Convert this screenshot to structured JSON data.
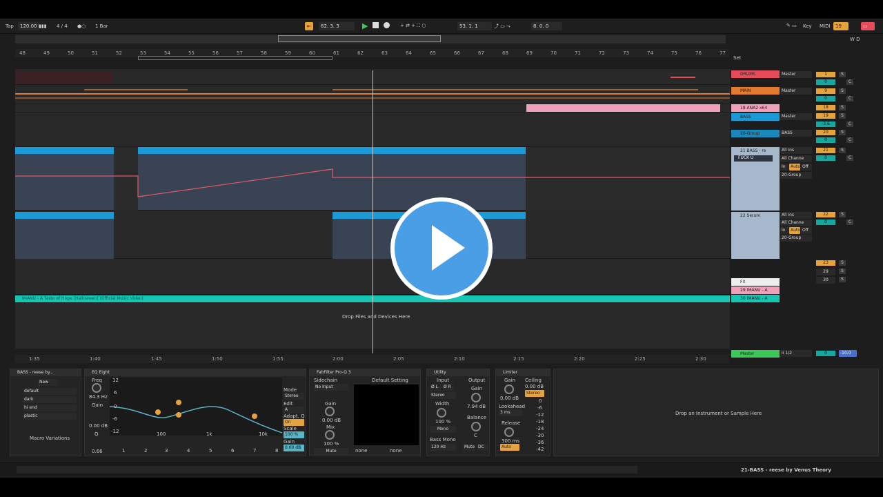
{
  "transport": {
    "tap": "Tap",
    "tempo": "120.00",
    "sig": "4 / 4",
    "quant": "1 Bar",
    "position": "62.   3.   3",
    "loop_end": "53.   1.   1",
    "loop_len": "8.   0.   0",
    "key": "Key",
    "midi": "MIDI",
    "cpu": "19 %",
    "d_label": "D",
    "w_label": "W"
  },
  "overview": {
    "ruler": [
      "48",
      "49",
      "50",
      "51",
      "52",
      "53",
      "54",
      "55",
      "56",
      "57",
      "58",
      "59",
      "60",
      "61",
      "62",
      "63",
      "64",
      "65",
      "66",
      "67",
      "68",
      "69",
      "70",
      "71",
      "72",
      "73",
      "74",
      "75",
      "76",
      "77"
    ],
    "set": "Set"
  },
  "timeline": {
    "times": [
      "1:35",
      "1:40",
      "1:45",
      "1:50",
      "1:55",
      "2:00",
      "2:05",
      "2:10",
      "2:15",
      "2:20",
      "2:25",
      "2:30"
    ]
  },
  "tracks": [
    {
      "name": "DRUMS",
      "route": "Master",
      "num": "1",
      "val": "0",
      "s": "S",
      "c": "C"
    },
    {
      "name": "MAIN",
      "route": "Master",
      "num": "9",
      "val": "0",
      "s": "S",
      "c": "C"
    },
    {
      "name": "18 ANA2 x64",
      "num": "18",
      "s": "S"
    },
    {
      "name": "BASS",
      "route": "Master",
      "num": "19",
      "val": "-3.6",
      "s": "S",
      "c": "C"
    },
    {
      "name": "20-Group",
      "route": "BASS",
      "num": "20",
      "val": "0",
      "s": "S",
      "c": "C"
    },
    {
      "name": "21 BASS - re",
      "route": "All Ins",
      "route2": "All Channe",
      "num": "21",
      "val": "0",
      "s": "S",
      "c": "C",
      "clip": "FUCK U",
      "mon_in": "In",
      "mon_auto": "Auto",
      "mon_off": "Off",
      "out": "20-Group"
    },
    {
      "name": "22 Serum",
      "route": "All Ins",
      "route2": "All Channe",
      "num": "22",
      "val": "0",
      "s": "S",
      "c": "C",
      "mon_in": "In",
      "mon_auto": "Auto",
      "mon_off": "Off",
      "out": "20-Group"
    },
    {
      "name": "FX",
      "num": "23",
      "s": "S"
    },
    {
      "name": "29 IMANU - A",
      "num": "29",
      "s": "S"
    },
    {
      "name": "30 IMANU - A",
      "num": "30",
      "s": "S"
    }
  ],
  "audio_clip": "IMANU - A Taste of Hope [Halloween] (Official Music Video)",
  "drop_files": "Drop Files and Devices Here",
  "master": {
    "name": "Master",
    "route": "ii 1/2",
    "val": "0",
    "vol": "-10.0"
  },
  "devices": {
    "rack": {
      "title": "BASS - reese by...",
      "new": "New",
      "macros": [
        "default",
        "dark",
        "hi end",
        "plastic"
      ],
      "footer": "Macro Variations"
    },
    "eq": {
      "title": "EQ Eight",
      "freq_label": "Freq",
      "freq": "84.3 Hz",
      "gain_label": "Gain",
      "gain": "0.00 dB",
      "q_label": "Q",
      "q": "0.66",
      "mode_label": "Mode",
      "mode": "Stereo",
      "edit_label": "Edit",
      "edit": "A",
      "adapt_label": "Adapt. Q",
      "adapt": "On",
      "scale_label": "Scale",
      "scale": "100 %",
      "gain2_label": "Gain",
      "gain2": "0.00 dB",
      "axis": [
        "12",
        "6",
        "0",
        "-6",
        "-12"
      ],
      "freqs": [
        "100",
        "1k",
        "10k"
      ],
      "bands": [
        "1",
        "2",
        "3",
        "4",
        "5",
        "6",
        "7",
        "8"
      ]
    },
    "fab": {
      "title": "FabFilter Pro-Q 3",
      "side_label": "Sidechain",
      "side": "No Input",
      "gain_label": "Gain",
      "gain": "0.00 dB",
      "mix_label": "Mix",
      "mix": "100 %",
      "mute": "Mute",
      "preset": "Default Setting",
      "none1": "none",
      "none2": "none"
    },
    "util": {
      "title": "Utility",
      "input": "Input",
      "output": "Output",
      "l": "Ø L",
      "r": "Ø R",
      "mode": "Stereo",
      "gain_label": "Gain",
      "gain": "7.94 dB",
      "width_label": "Width",
      "width": "100 %",
      "mono": "Mono",
      "balance_label": "Balance",
      "balance": "C",
      "bassmono": "Bass Mono",
      "bassfreq": "120 Hz",
      "mute": "Mute",
      "dc": "DC"
    },
    "lim": {
      "title": "Limiter",
      "gain_label": "Gain",
      "gain": "0.00 dB",
      "ceil_label": "Ceiling",
      "ceil": "0.00 dB",
      "stereo": "Stereo",
      "look_label": "Lookahead",
      "look": "3 ms",
      "rel_label": "Release",
      "rel": "300 ms",
      "auto": "Auto",
      "meter": [
        "0",
        "-6",
        "-12",
        "-18",
        "-24",
        "-30",
        "-36",
        "-42"
      ]
    },
    "drop_inst": "Drop an Instrument or Sample Here"
  },
  "status": {
    "track_info": "21-BASS - reese by Venus Theory"
  },
  "colors": {
    "accent": "#e6a33c",
    "blue": "#1a9bd7",
    "teal": "#16c6b2",
    "red": "#e64b5a",
    "orange": "#e07b30",
    "pink": "#f0a0b8"
  }
}
